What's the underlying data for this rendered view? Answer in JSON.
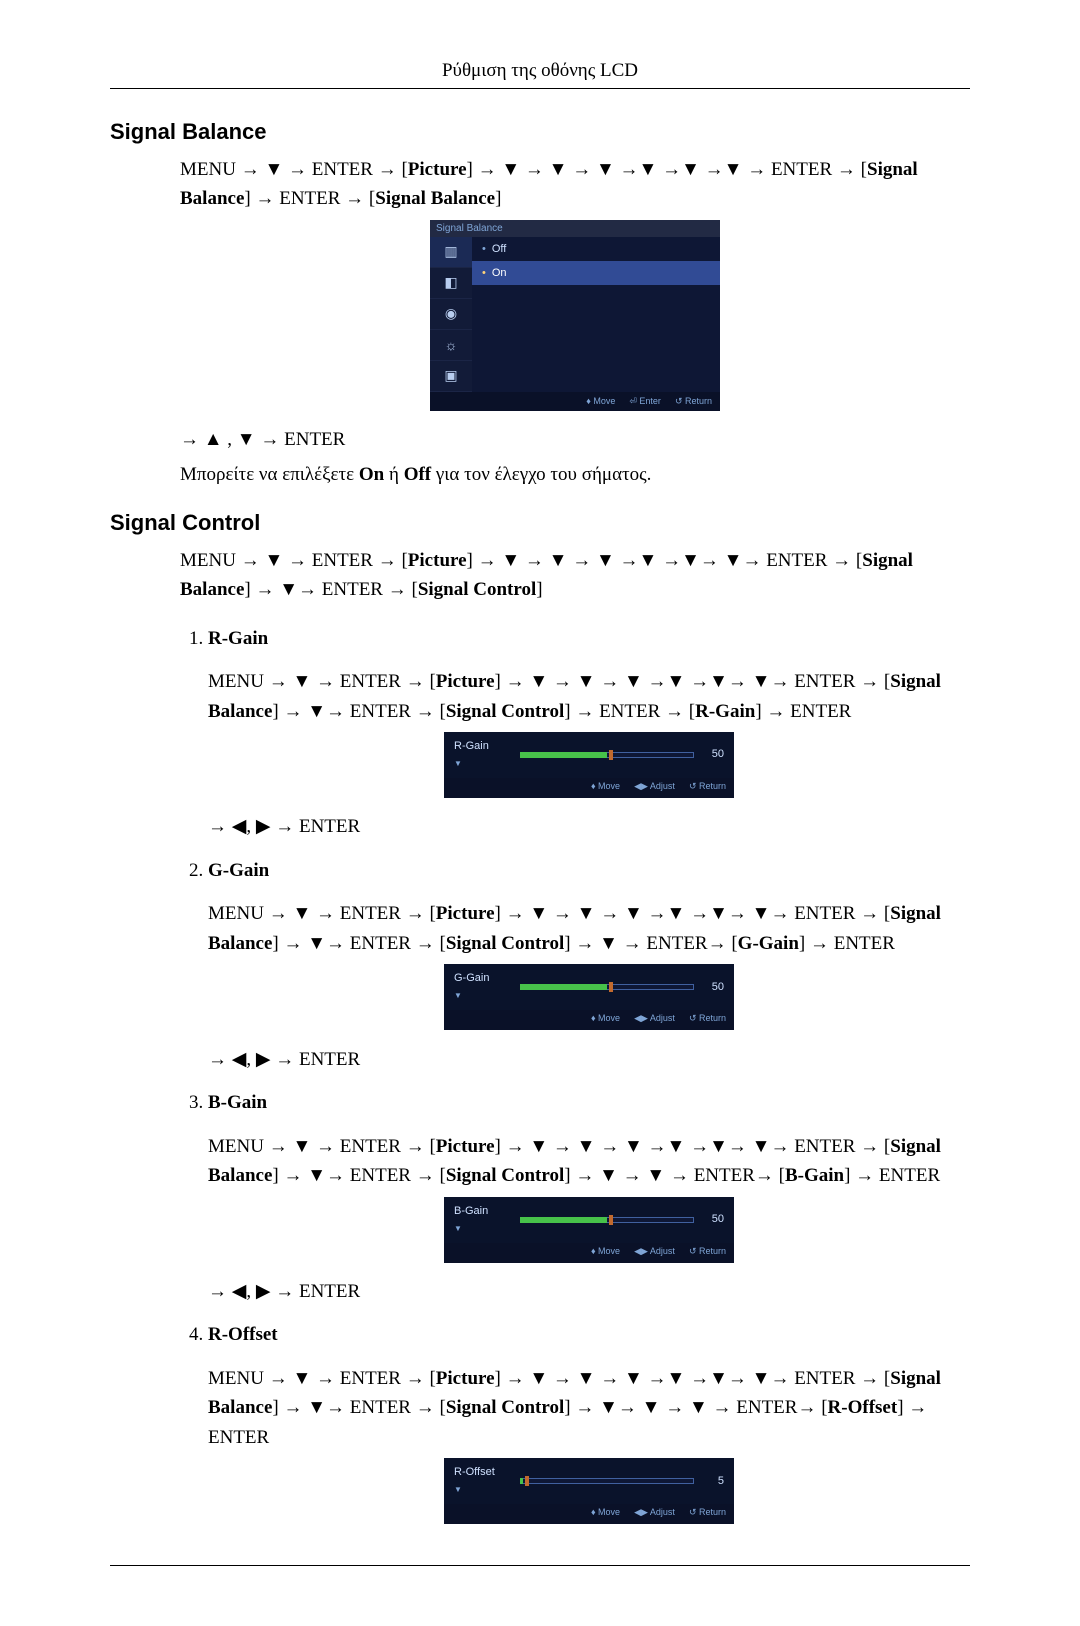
{
  "header": "Ρύθμιση της οθόνης LCD",
  "sections": {
    "signal_balance": {
      "title": "Signal Balance",
      "path": "MENU → ▼ → ENTER → [<b>Picture</b>] → ▼ → ▼ → ▼ →▼ →▼ →▼ → ENTER → [<b>Signal Balance</b>] → ENTER → [<b>Signal Balance</b>]",
      "nav_after": "→ ▲ , ▼ → ENTER",
      "note": "Μπορείτε να επιλέξετε <b>On</b> ή <b>Off</b> για τον έλεγχο του σήματος.",
      "osd": {
        "title": "Signal Balance",
        "options": [
          "Off",
          "On"
        ],
        "selected": "On",
        "footer": {
          "move": "Move",
          "enter": "Enter",
          "ret": "Return"
        }
      }
    },
    "signal_control": {
      "title": "Signal Control",
      "path": "MENU → ▼ → ENTER → [<b>Picture</b>] → ▼ → ▼ → ▼ →▼ →▼→ ▼→ ENTER → [<b>Signal Balance</b>] → ▼→ ENTER → [<b>Signal Control</b>]",
      "items": [
        {
          "n": "1.",
          "name": "R-Gain",
          "path": "MENU → ▼ → ENTER → [<b>Picture</b>] → ▼ → ▼ → ▼ →▼ →▼→ ▼→ ENTER → [<b>Signal Bal­ance</b>] → ▼→ ENTER → [<b>Signal Control</b>] → ENTER → [<b>R-Gain</b>] → ENTER",
          "nav_after": "→ ◀, ▶ → ENTER",
          "slider": {
            "label": "R-Gain",
            "value": 50,
            "max": 100
          },
          "footer": {
            "move": "Move",
            "adjust": "Adjust",
            "ret": "Return"
          }
        },
        {
          "n": "2.",
          "name": "G-Gain",
          "path": "MENU → ▼ → ENTER → [<b>Picture</b>] → ▼ → ▼ → ▼ →▼ →▼→ ▼→ ENTER → [<b>Signal Bal­ance</b>] → ▼→ ENTER → [<b>Signal Control</b>] → ▼ → ENTER→ [<b>G-Gain</b>] → ENTER",
          "nav_after": "→ ◀, ▶ → ENTER",
          "slider": {
            "label": "G-Gain",
            "value": 50,
            "max": 100
          },
          "footer": {
            "move": "Move",
            "adjust": "Adjust",
            "ret": "Return"
          }
        },
        {
          "n": "3.",
          "name": "B-Gain",
          "path": "MENU → ▼ → ENTER → [<b>Picture</b>] → ▼ → ▼ → ▼ →▼ →▼→ ▼→ ENTER → [<b>Signal Bal­ance</b>] → ▼→ ENTER → [<b>Signal Control</b>] → ▼ → ▼ → ENTER→ [<b>B-Gain</b>] → ENTER",
          "nav_after": "→ ◀, ▶ → ENTER",
          "slider": {
            "label": "B-Gain",
            "value": 50,
            "max": 100
          },
          "footer": {
            "move": "Move",
            "adjust": "Adjust",
            "ret": "Return"
          }
        },
        {
          "n": "4.",
          "name": "R-Offset",
          "path": "MENU → ▼ → ENTER → [<b>Picture</b>] → ▼ → ▼ → ▼ →▼ →▼→ ▼→ ENTER → [<b>Signal Bal­ance</b>] → ▼→ ENTER → [<b>Signal Control</b>] → ▼→ ▼ → ▼ → ENTER→ [<b>R-Offset</b>] → ENTER",
          "nav_after": "",
          "slider": {
            "label": "R-Offset",
            "value": 5,
            "max": 100
          },
          "footer": {
            "move": "Move",
            "adjust": "Adjust",
            "ret": "Return"
          }
        }
      ]
    }
  }
}
